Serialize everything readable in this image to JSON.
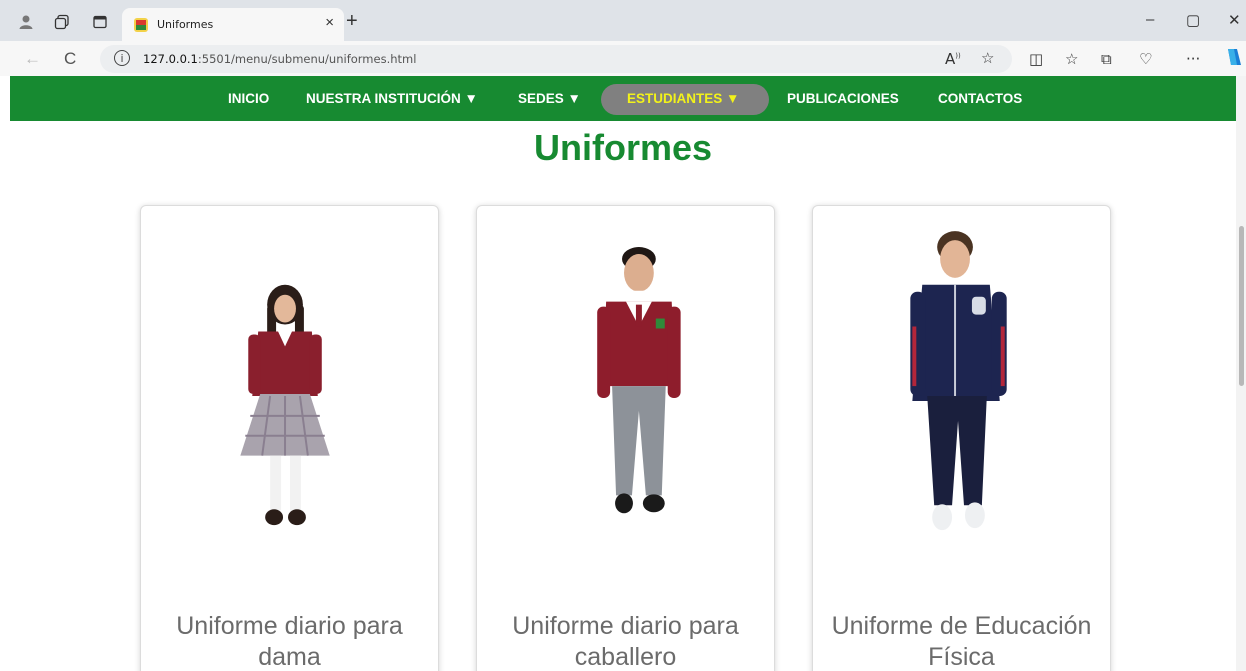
{
  "browser": {
    "tab_title": "Uniformes",
    "url_host": "127.0.0.1",
    "url_path": ":5501/menu/submenu/uniformes.html"
  },
  "site_nav": {
    "items": [
      {
        "label": "INICIO"
      },
      {
        "label": "NUESTRA INSTITUCIÓN ▼"
      },
      {
        "label": "SEDES ▼"
      },
      {
        "label": "ESTUDIANTES ▼"
      },
      {
        "label": "PUBLICACIONES"
      },
      {
        "label": "CONTACTOS"
      }
    ],
    "active_index": 3,
    "colors": {
      "bar": "#178a31",
      "active_pill": "#808080",
      "active_text": "#f2f21a"
    }
  },
  "page": {
    "title": "Uniformes",
    "title_color": "#178a31"
  },
  "cards": [
    {
      "caption": "Uniforme diario para dama",
      "image": "student-girl-daily-uniform"
    },
    {
      "caption": "Uniforme diario para caballero",
      "image": "student-boy-daily-uniform"
    },
    {
      "caption": "Uniforme de Educación Física",
      "image": "student-pe-tracksuit"
    }
  ]
}
